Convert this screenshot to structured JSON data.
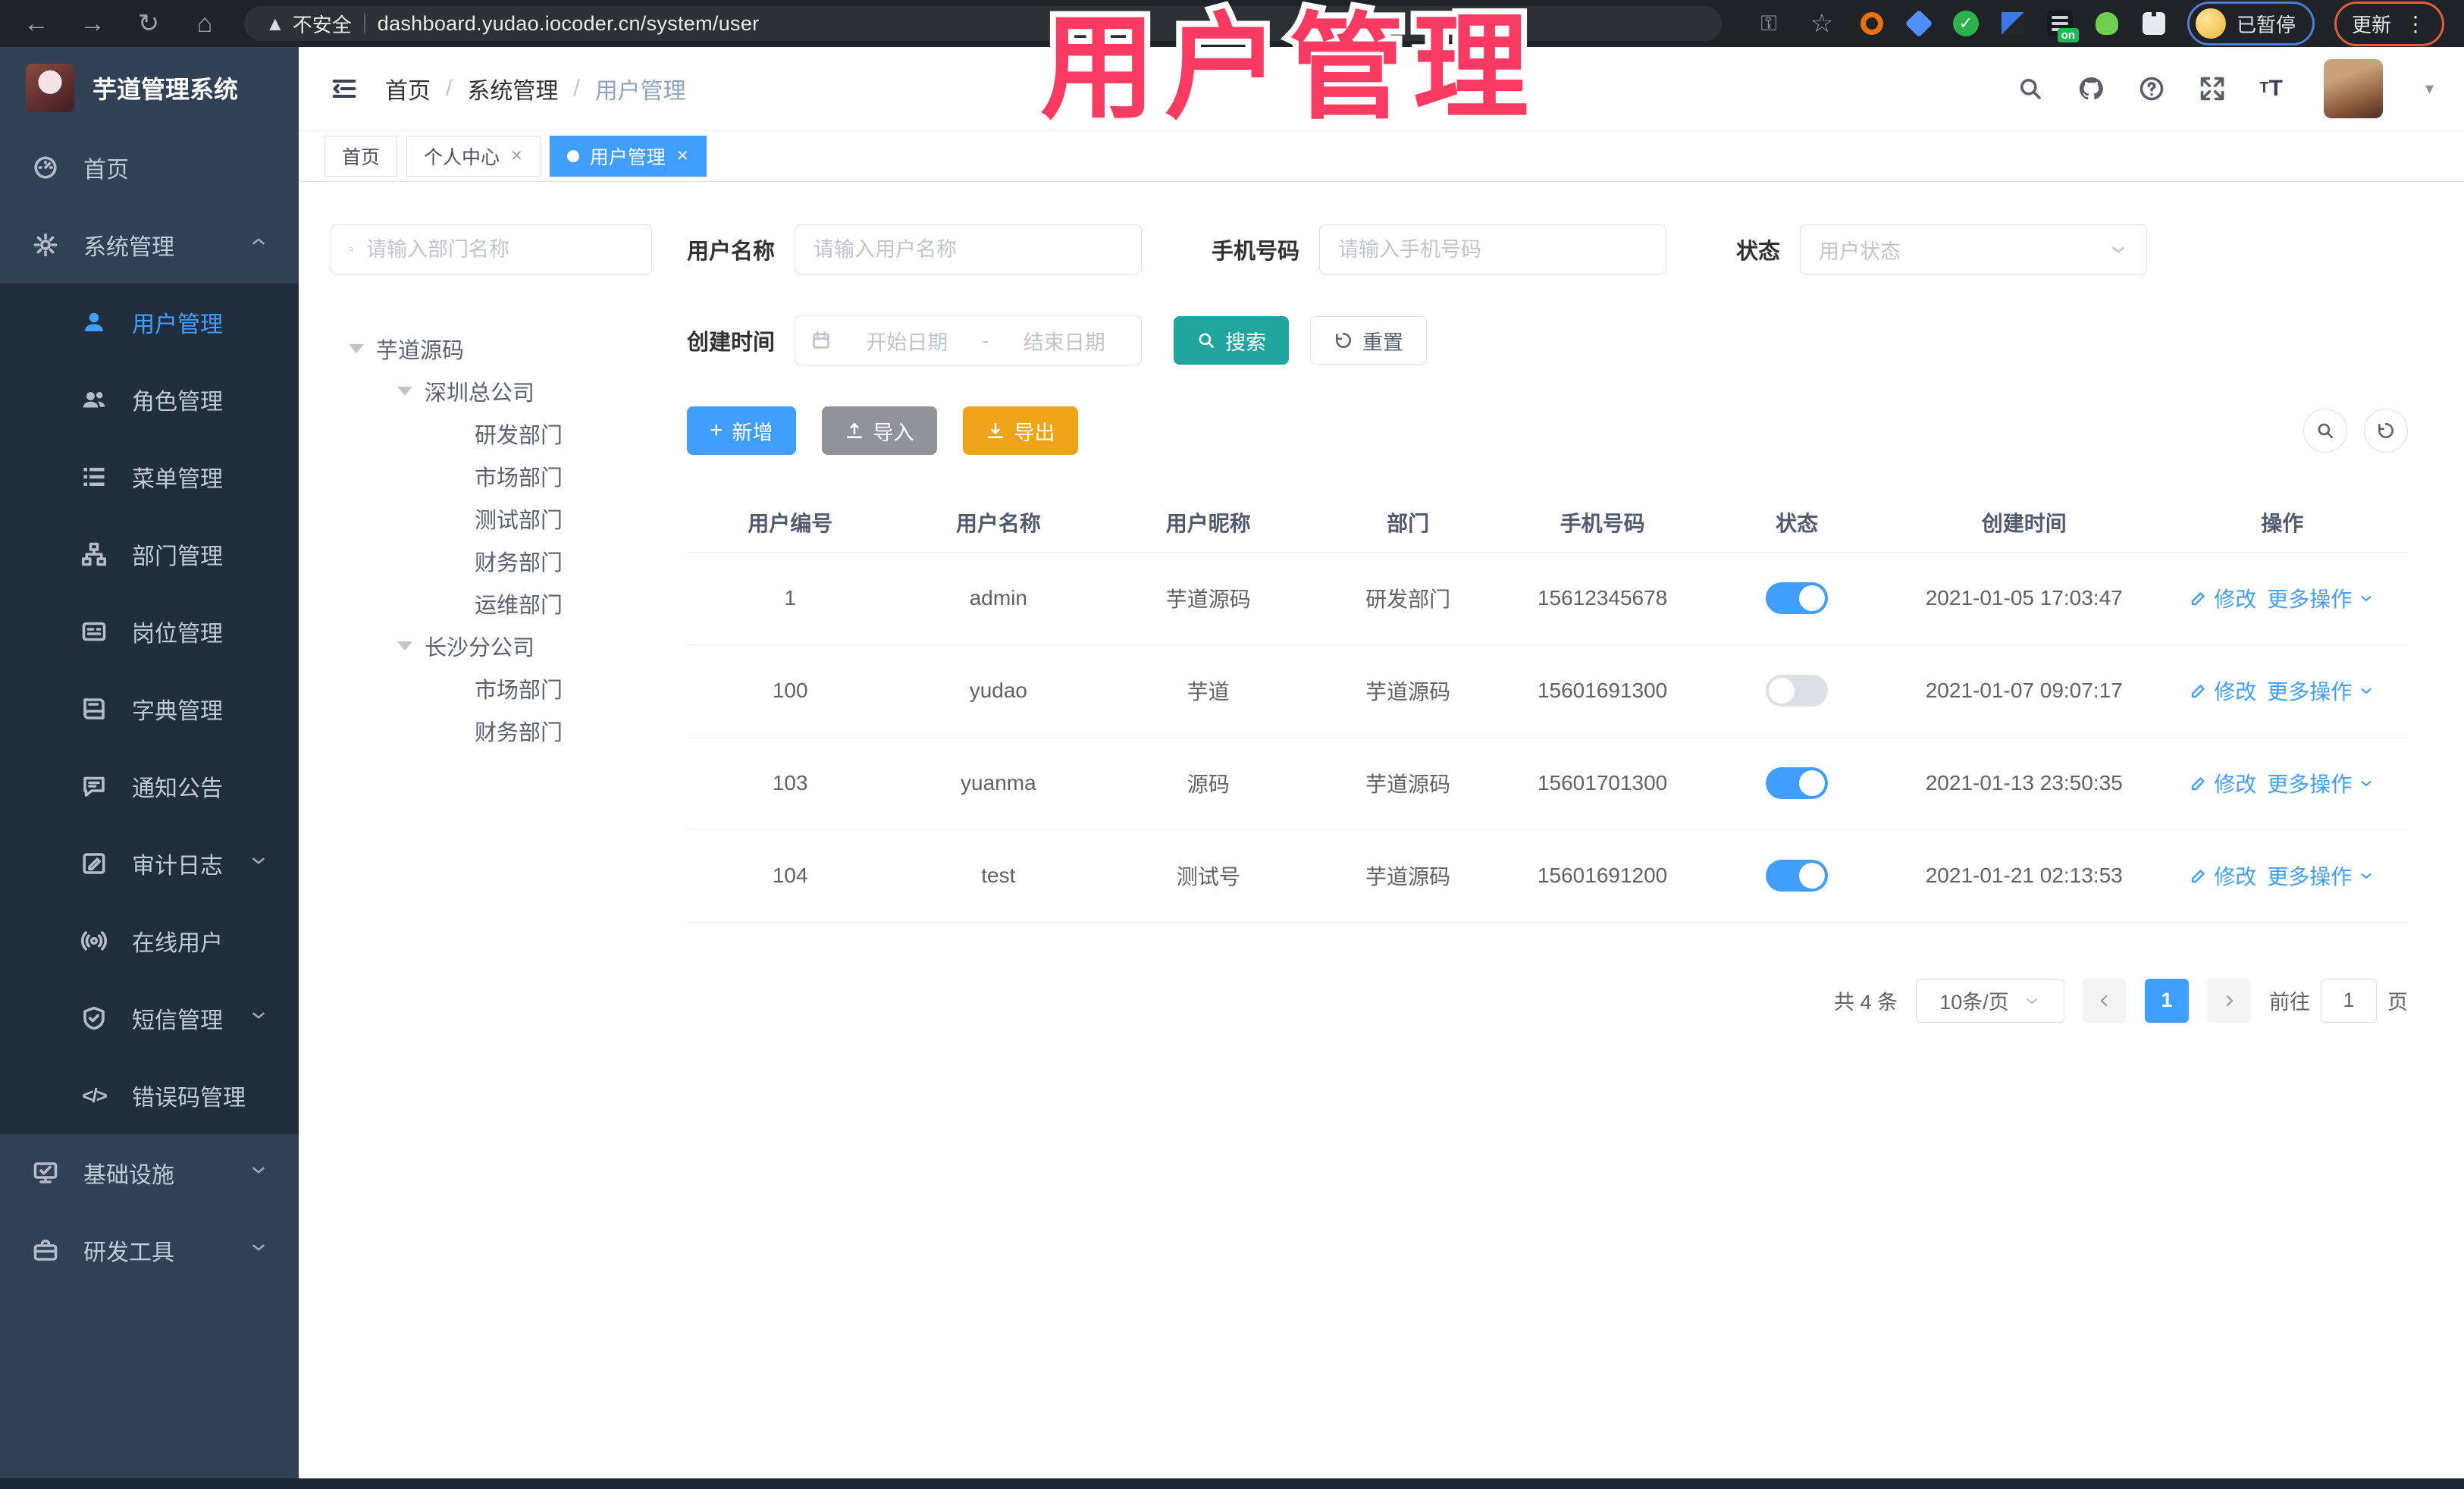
{
  "browser": {
    "security_warning": "不安全",
    "url": "dashboard.yudao.iocoder.cn/system/user",
    "extension_on_badge": "on",
    "paused_badge": "已暂停",
    "update_button": "更新"
  },
  "watermark": "用户管理",
  "sidebar": {
    "logo_title": "芋道管理系统",
    "items": [
      {
        "label": "首页"
      },
      {
        "label": "系统管理"
      },
      {
        "label": "用户管理"
      },
      {
        "label": "角色管理"
      },
      {
        "label": "菜单管理"
      },
      {
        "label": "部门管理"
      },
      {
        "label": "岗位管理"
      },
      {
        "label": "字典管理"
      },
      {
        "label": "通知公告"
      },
      {
        "label": "审计日志"
      },
      {
        "label": "在线用户"
      },
      {
        "label": "短信管理"
      },
      {
        "label": "错误码管理"
      },
      {
        "label": "基础设施"
      },
      {
        "label": "研发工具"
      }
    ]
  },
  "header": {
    "breadcrumb": [
      "首页",
      "系统管理",
      "用户管理"
    ]
  },
  "tabs": [
    {
      "label": "首页"
    },
    {
      "label": "个人中心"
    },
    {
      "label": "用户管理"
    }
  ],
  "tree": {
    "search_placeholder": "请输入部门名称",
    "nodes": [
      {
        "label": "芋道源码"
      },
      {
        "label": "深圳总公司"
      },
      {
        "label": "研发部门"
      },
      {
        "label": "市场部门"
      },
      {
        "label": "测试部门"
      },
      {
        "label": "财务部门"
      },
      {
        "label": "运维部门"
      },
      {
        "label": "长沙分公司"
      },
      {
        "label": "市场部门"
      },
      {
        "label": "财务部门"
      }
    ]
  },
  "filters": {
    "username": {
      "label": "用户名称",
      "placeholder": "请输入用户名称"
    },
    "mobile": {
      "label": "手机号码",
      "placeholder": "请输入手机号码"
    },
    "status": {
      "label": "状态",
      "placeholder": "用户状态"
    },
    "create_time": {
      "label": "创建时间",
      "start_placeholder": "开始日期",
      "separator": "-",
      "end_placeholder": "结束日期"
    },
    "search_button": "搜索",
    "reset_button": "重置"
  },
  "toolbar": {
    "add_button": "新增",
    "import_button": "导入",
    "export_button": "导出"
  },
  "table": {
    "columns": [
      "用户编号",
      "用户名称",
      "用户昵称",
      "部门",
      "手机号码",
      "状态",
      "创建时间",
      "操作"
    ],
    "edit_label": "修改",
    "more_label": "更多操作",
    "rows": [
      {
        "id": "1",
        "username": "admin",
        "nickname": "芋道源码",
        "dept": "研发部门",
        "mobile": "15612345678",
        "enabled": true,
        "created": "2021-01-05 17:03:47"
      },
      {
        "id": "100",
        "username": "yudao",
        "nickname": "芋道",
        "dept": "芋道源码",
        "mobile": "15601691300",
        "enabled": false,
        "created": "2021-01-07 09:07:17"
      },
      {
        "id": "103",
        "username": "yuanma",
        "nickname": "源码",
        "dept": "芋道源码",
        "mobile": "15601701300",
        "enabled": true,
        "created": "2021-01-13 23:50:35"
      },
      {
        "id": "104",
        "username": "test",
        "nickname": "测试号",
        "dept": "芋道源码",
        "mobile": "15601691200",
        "enabled": true,
        "created": "2021-01-21 02:13:53"
      }
    ]
  },
  "pagination": {
    "total": "共 4 条",
    "page_size": "10条/页",
    "current_page": "1",
    "goto_label": "前往",
    "goto_value": "1",
    "goto_suffix": "页"
  },
  "colors": {
    "primary": "#409eff",
    "search_teal": "#21a59f",
    "export_yellow": "#f0a519",
    "sidebar_bg": "#304156",
    "submenu_bg": "#1f2d3d",
    "watermark_pink": "#fa3a60"
  }
}
